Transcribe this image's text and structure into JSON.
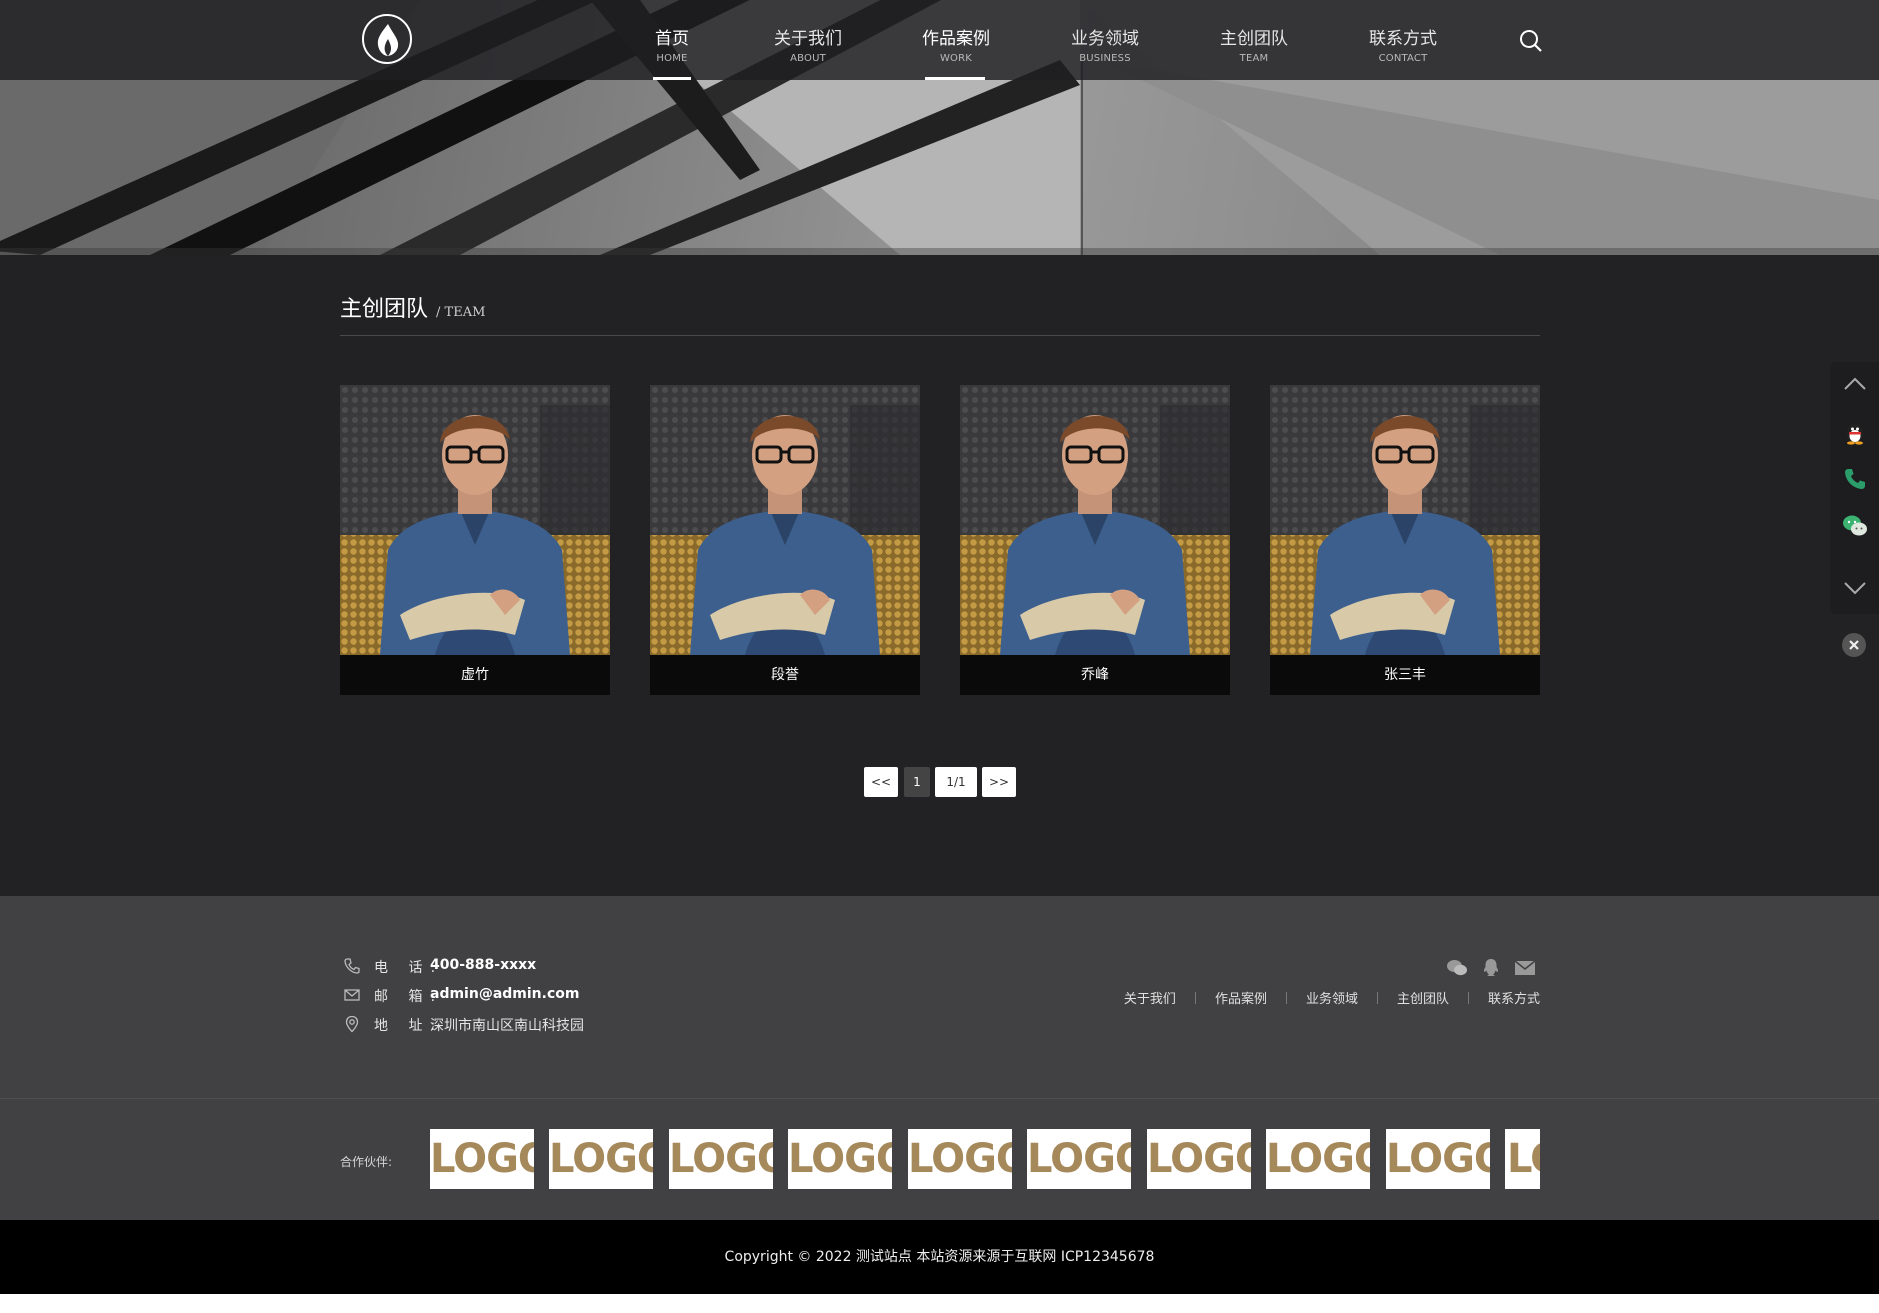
{
  "colors": {
    "header_bg": "#1e1e22",
    "main_bg": "#222224",
    "footer_bg": "#414143",
    "copyright_bg": "#000000",
    "logo_gold": "#a5895a"
  },
  "header": {
    "nav": [
      {
        "cn": "首页",
        "en": "HOME"
      },
      {
        "cn": "关于我们",
        "en": "ABOUT"
      },
      {
        "cn": "作品案例",
        "en": "WORK"
      },
      {
        "cn": "业务领域",
        "en": "BUSINESS"
      },
      {
        "cn": "主创团队",
        "en": "TEAM"
      },
      {
        "cn": "联系方式",
        "en": "CONTACT"
      }
    ],
    "search_icon": "search-icon"
  },
  "section": {
    "title": "主创团队",
    "subtitle": "/ TEAM"
  },
  "team": [
    {
      "name": "虚竹"
    },
    {
      "name": "段誉"
    },
    {
      "name": "乔峰"
    },
    {
      "name": "张三丰"
    }
  ],
  "pager": {
    "prev": "<<",
    "current": "1",
    "total": "1/1",
    "next": ">>"
  },
  "contact": {
    "phone_label": "电 话:",
    "phone": "400-888-xxxx",
    "email_label": "邮 箱:",
    "email": "admin@admin.com",
    "address_label": "地 址:",
    "address": "深圳市南山区南山科技园"
  },
  "footer_links": [
    "关于我们",
    "作品案例",
    "业务领域",
    "主创团队",
    "联系方式"
  ],
  "partners": {
    "label": "合作伙伴:",
    "logos": [
      "LOGO",
      "LOGO",
      "LOGO",
      "LOGO",
      "LOGO",
      "LOGO",
      "LOGO",
      "LOGO",
      "LOGO",
      "LOGO"
    ]
  },
  "copyright": "Copyright © 2022 测试站点 本站资源来源于互联网 ICP12345678"
}
